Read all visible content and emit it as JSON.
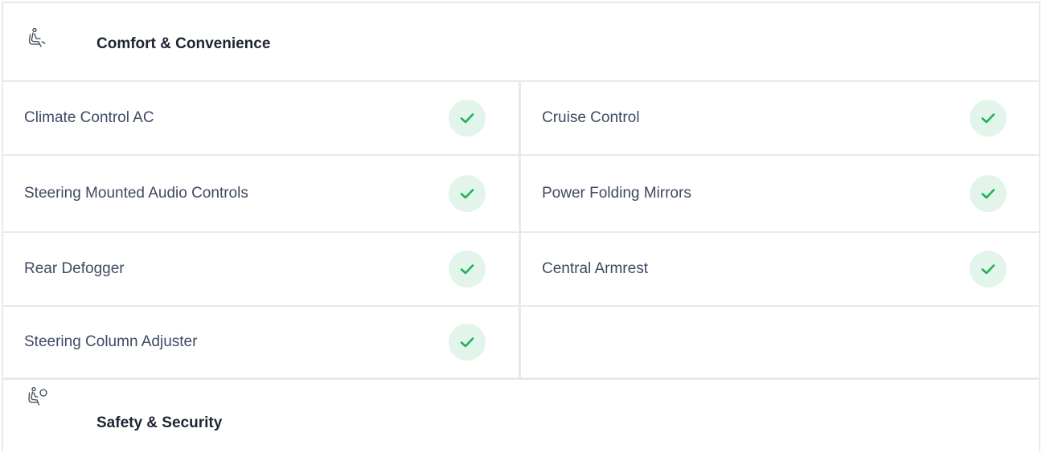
{
  "sections": {
    "comfort": {
      "title": "Comfort & Convenience",
      "icon": "seat-icon",
      "features": [
        {
          "label": "Climate Control AC",
          "available": true
        },
        {
          "label": "Cruise Control",
          "available": true
        },
        {
          "label": "Steering Mounted Audio Controls",
          "available": true
        },
        {
          "label": "Power Folding Mirrors",
          "available": true
        },
        {
          "label": "Rear Defogger",
          "available": true
        },
        {
          "label": "Central Armrest",
          "available": true
        },
        {
          "label": "Steering Column Adjuster",
          "available": true
        }
      ]
    },
    "safety": {
      "title": "Safety & Security",
      "icon": "airbag-icon"
    }
  },
  "colors": {
    "check_green": "#20b25a",
    "check_bg": "#e3f5ea",
    "border": "#e6e9ee"
  }
}
